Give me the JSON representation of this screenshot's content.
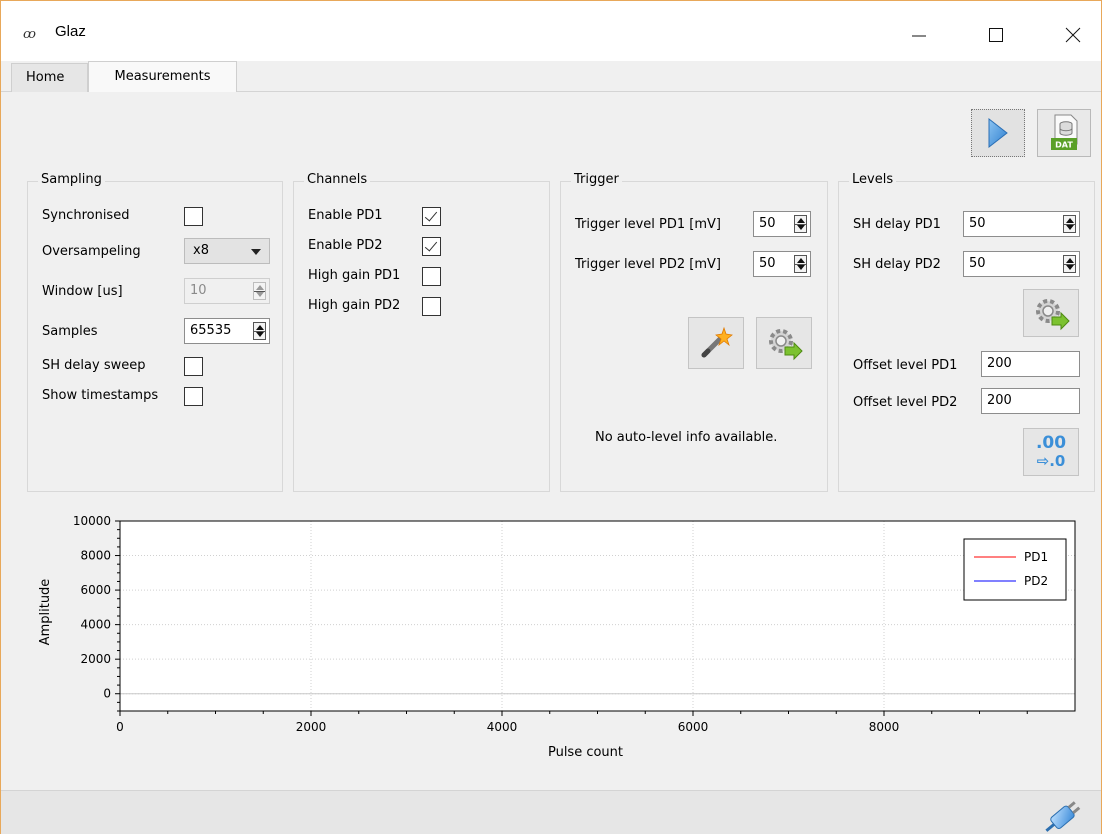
{
  "window": {
    "title": "Glaz",
    "min_glyph": "—",
    "max_glyph": "☐",
    "close_glyph": "✕"
  },
  "tabs": [
    {
      "label": "Home",
      "active": false
    },
    {
      "label": "Measurements",
      "active": true
    }
  ],
  "toolbar": {
    "start_icon": "play-icon",
    "export_icon": "dat-file-icon",
    "export_badge": "DAT"
  },
  "sampling": {
    "title": "Sampling",
    "synchronised_label": "Synchronised",
    "synchronised_checked": false,
    "oversampling_label": "Oversampeling",
    "oversampling_value": "x8",
    "window_label": "Window [us]",
    "window_value": "10",
    "samples_label": "Samples",
    "samples_value": "65535",
    "sh_delay_sweep_label": "SH delay sweep",
    "sh_delay_sweep_checked": false,
    "show_timestamps_label": "Show timestamps",
    "show_timestamps_checked": false
  },
  "channels": {
    "title": "Channels",
    "items": [
      {
        "label": "Enable PD1",
        "checked": true
      },
      {
        "label": "Enable PD2",
        "checked": true
      },
      {
        "label": "High gain PD1",
        "checked": false
      },
      {
        "label": "High gain PD2",
        "checked": false
      }
    ]
  },
  "trigger": {
    "title": "Trigger",
    "pd1_label": "Trigger level PD1 [mV]",
    "pd1_value": "50",
    "pd2_label": "Trigger level PD2 [mV]",
    "pd2_value": "50",
    "auto_level_icon": "magic-wand-icon",
    "apply_icon": "gear-arrow-icon",
    "info_text": "No auto-level info available."
  },
  "levels": {
    "title": "Levels",
    "sh_pd1_label": "SH delay PD1",
    "sh_pd1_value": "50",
    "sh_pd2_label": "SH delay PD2",
    "sh_pd2_value": "50",
    "apply_icon": "gear-arrow-icon",
    "offset_pd1_label": "Offset level PD1",
    "offset_pd1_value": "200",
    "offset_pd2_label": "Offset level PD2",
    "offset_pd2_value": "200",
    "reset_icon_top": ".00",
    "reset_icon_bottom": "⇨.0"
  },
  "colors": {
    "pd1": "#ff0000",
    "pd2": "#0000ff",
    "accent_blue": "#4a90d9"
  },
  "chart_data": {
    "type": "line",
    "title": "",
    "xlabel": "Pulse count",
    "ylabel": "Amplitude",
    "xlim": [
      0,
      10000
    ],
    "ylim": [
      -1000,
      10000
    ],
    "x_ticks": [
      0,
      2000,
      4000,
      6000,
      8000
    ],
    "y_ticks": [
      0,
      2000,
      4000,
      6000,
      8000,
      10000
    ],
    "grid": true,
    "legend_position": "top-right",
    "series": [
      {
        "name": "PD1",
        "color": "#ff0000",
        "x": [],
        "y": []
      },
      {
        "name": "PD2",
        "color": "#0000ff",
        "x": [],
        "y": []
      }
    ]
  },
  "statusbar": {
    "connection_icon": "plug-icon"
  }
}
